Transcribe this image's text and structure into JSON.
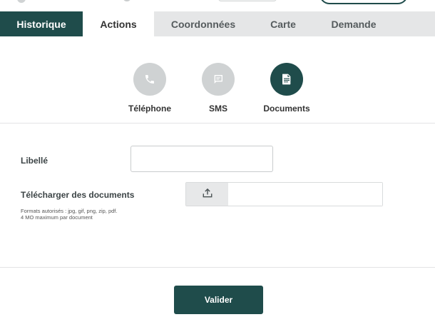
{
  "tabs": {
    "historique": "Historique",
    "actions": "Actions",
    "coordonnees": "Coordonnées",
    "carte": "Carte",
    "demande": "Demande"
  },
  "channels": {
    "telephone": {
      "label": "Téléphone",
      "icon": "phone-icon"
    },
    "sms": {
      "label": "SMS",
      "icon": "message-icon"
    },
    "documents": {
      "label": "Documents",
      "icon": "document-icon"
    }
  },
  "form": {
    "libelle_label": "Libellé",
    "libelle_value": "",
    "upload_label": "Télécharger des documents",
    "upload_icon": "upload-icon",
    "formats_hint": "Formats autorisés : jpg, gif, png, zip, pdf.",
    "size_hint": "4 MO maximum par document",
    "submit_label": "Valider"
  },
  "colors": {
    "primary": "#1f4c4b",
    "tab_bar": "#e5e6e7",
    "inactive_circle": "#cfd2d3"
  }
}
